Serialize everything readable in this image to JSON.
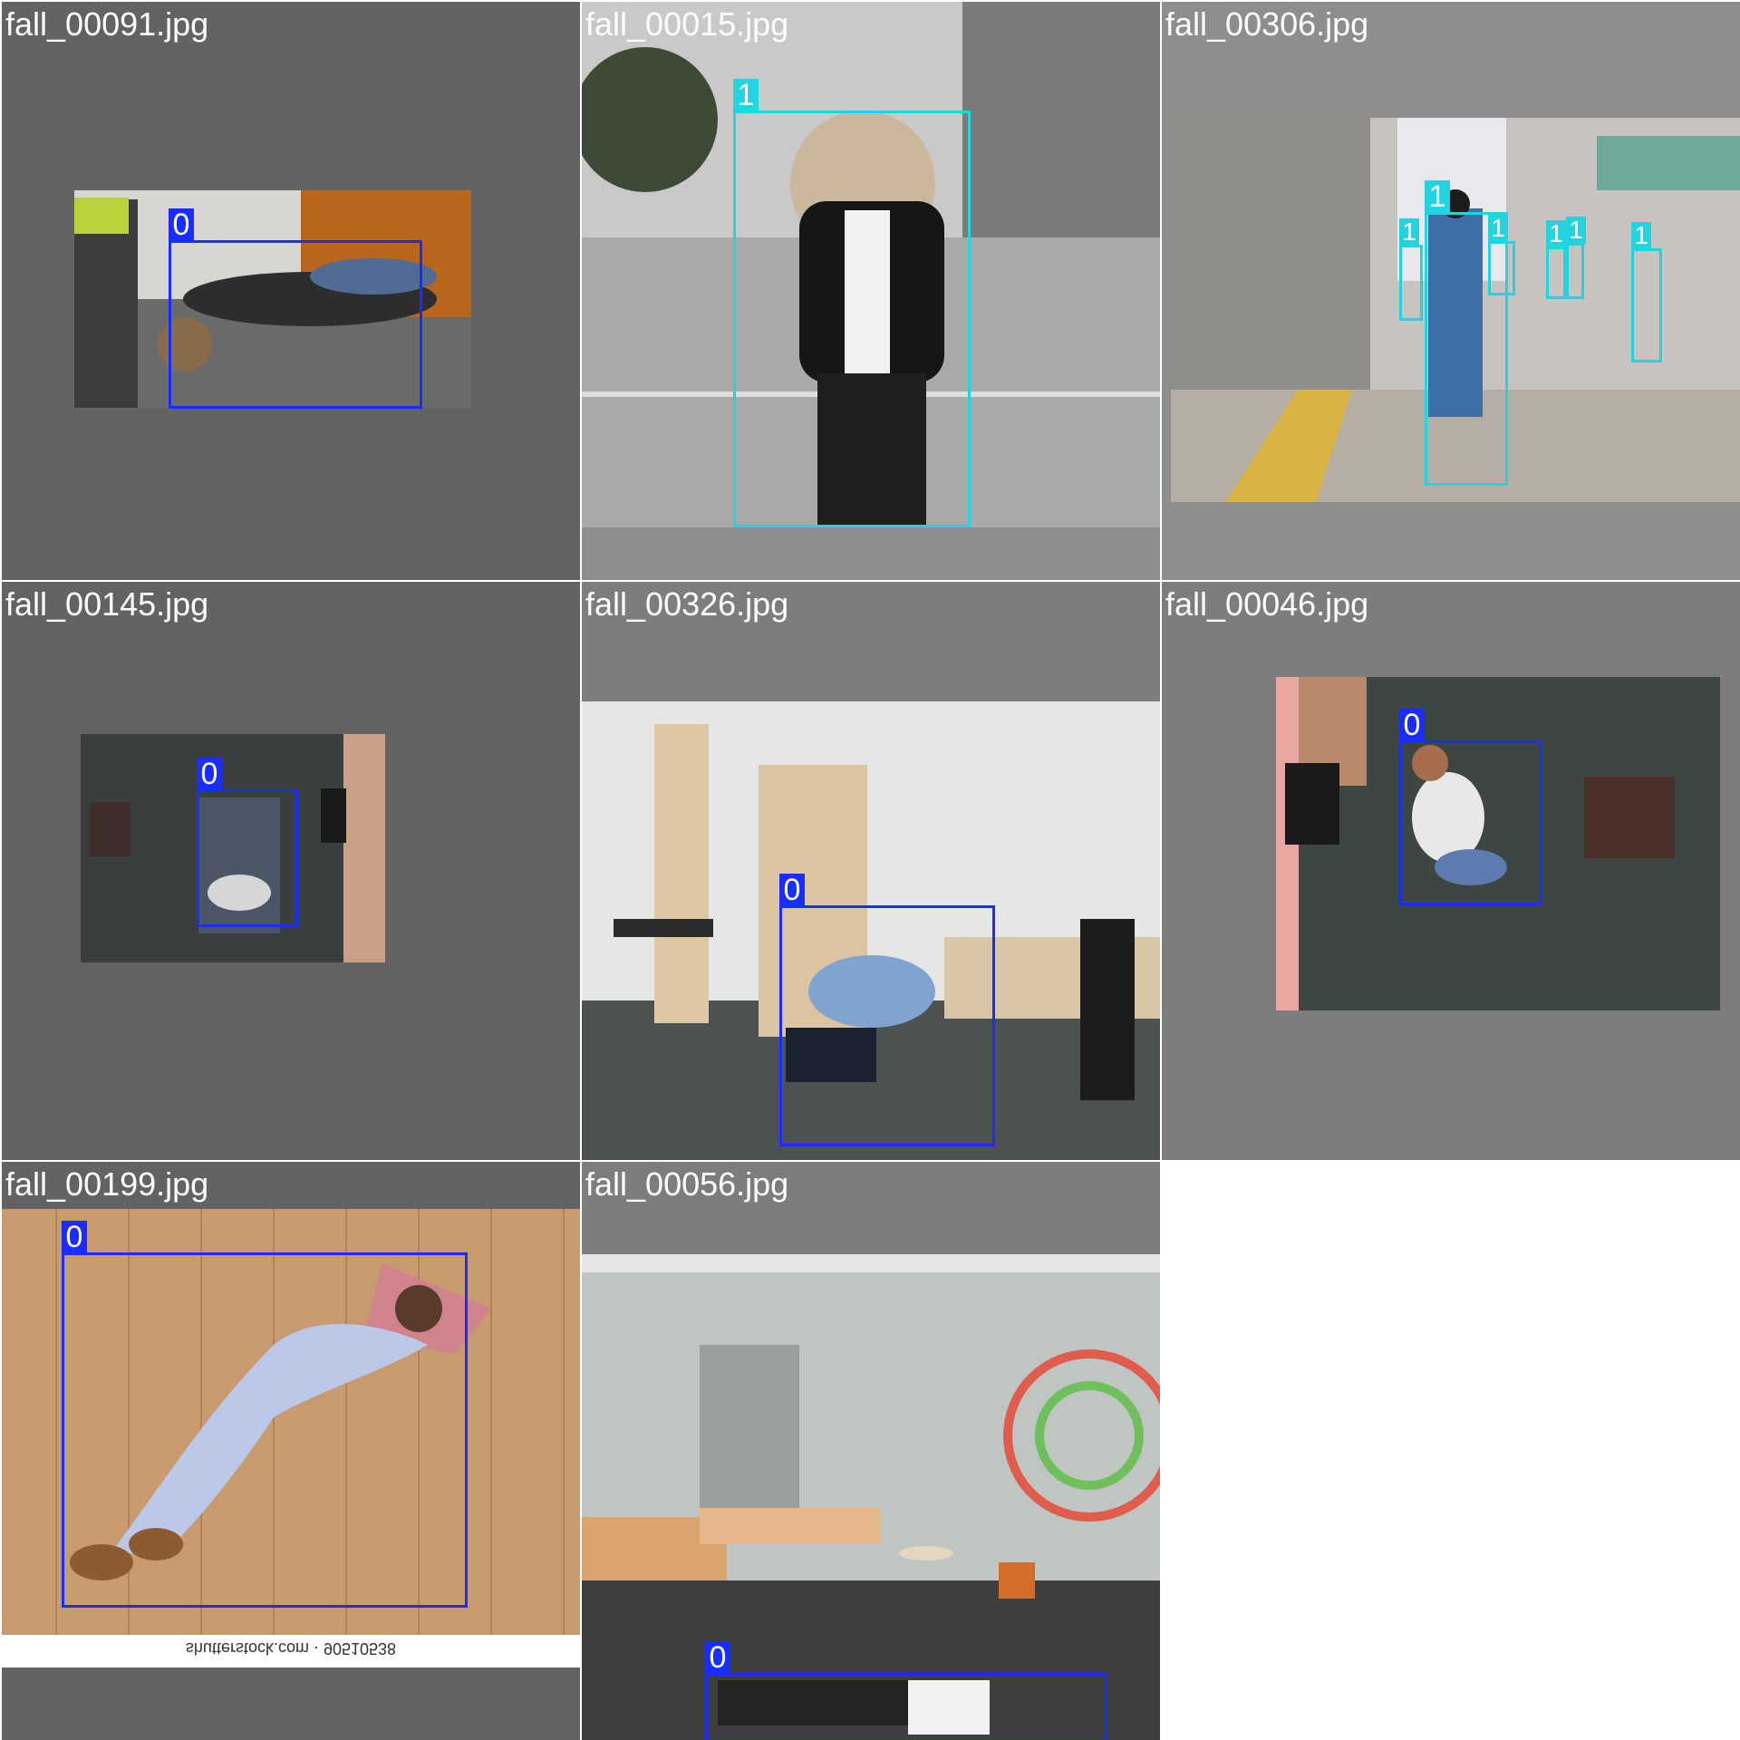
{
  "mosaic": {
    "tiles": [
      {
        "filename": "fall_00091.jpg",
        "labels": [
          "0"
        ]
      },
      {
        "filename": "fall_00015.jpg",
        "labels": [
          "1"
        ]
      },
      {
        "filename": "fall_00306.jpg",
        "labels": [
          "1",
          "1",
          "1",
          "1",
          "1",
          "1"
        ]
      },
      {
        "filename": "fall_00145.jpg",
        "labels": [
          "0"
        ]
      },
      {
        "filename": "fall_00326.jpg",
        "labels": [
          "0"
        ]
      },
      {
        "filename": "fall_00046.jpg",
        "labels": [
          "0"
        ]
      },
      {
        "filename": "fall_00199.jpg",
        "labels": [
          "0"
        ],
        "watermark": "shutterstock.com · 90510538"
      },
      {
        "filename": "fall_00056.jpg",
        "labels": [
          "0"
        ]
      }
    ],
    "colors": {
      "class_0": "#1a2dff",
      "class_1": "#22d3e0"
    }
  }
}
